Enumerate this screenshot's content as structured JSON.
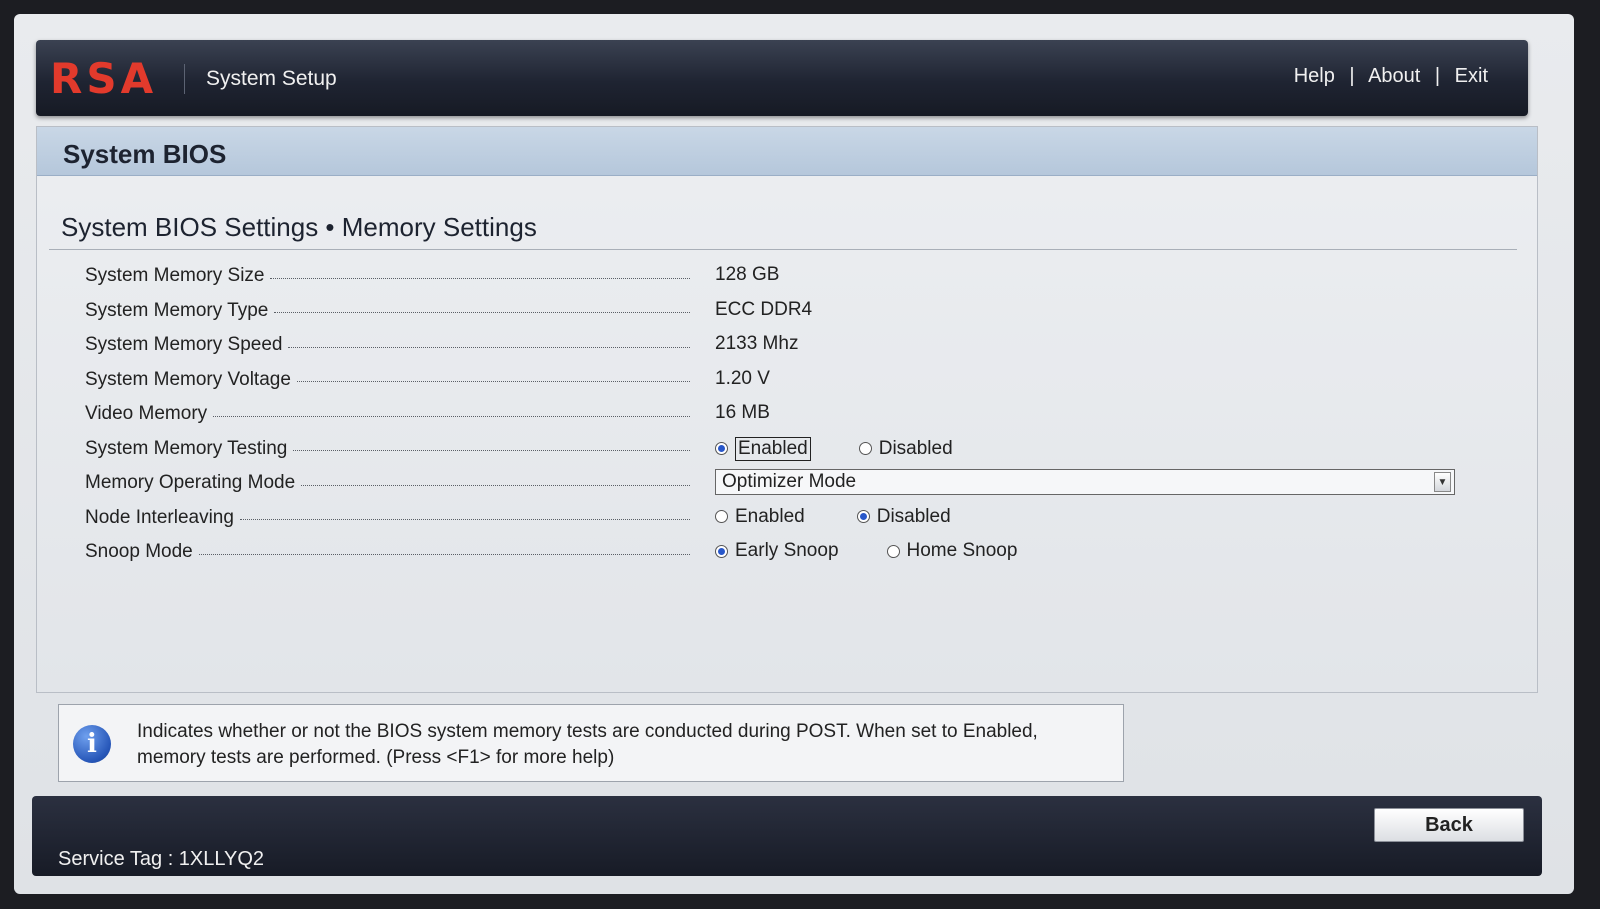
{
  "header": {
    "brand": "RSA",
    "title": "System Setup",
    "links": {
      "help": "Help",
      "about": "About",
      "exit": "Exit"
    },
    "separator": "|"
  },
  "panel": {
    "title": "System BIOS",
    "section_title": "System BIOS Settings • Memory Settings"
  },
  "rows": [
    {
      "label": "System Memory Size",
      "value": "128 GB"
    },
    {
      "label": "System Memory Type",
      "value": "ECC DDR4"
    },
    {
      "label": "System Memory Speed",
      "value": "2133 Mhz"
    },
    {
      "label": "System Memory Voltage",
      "value": "1.20 V"
    },
    {
      "label": "Video Memory",
      "value": "16 MB"
    },
    {
      "label": "System Memory Testing",
      "options": [
        "Enabled",
        "Disabled"
      ],
      "selected": "Enabled"
    },
    {
      "label": "Memory Operating Mode",
      "select_value": "Optimizer Mode"
    },
    {
      "label": "Node Interleaving",
      "options": [
        "Enabled",
        "Disabled"
      ],
      "selected": "Disabled"
    },
    {
      "label": "Snoop Mode",
      "options": [
        "Early Snoop",
        "Home Snoop"
      ],
      "selected": "Early Snoop"
    }
  ],
  "help": {
    "icon": "info-icon",
    "text": "Indicates whether or not the BIOS system memory tests are conducted during POST. When set to Enabled, memory tests are performed. (Press <F1> for more help)"
  },
  "footer": {
    "service_tag": "Service Tag : 1XLLYQ2",
    "back_label": "Back"
  },
  "colors": {
    "brand_red": "#e23a2c",
    "header_dark": "#1f2432",
    "panel_head": "#c9d7e6",
    "radio_selected": "#2857c9"
  }
}
